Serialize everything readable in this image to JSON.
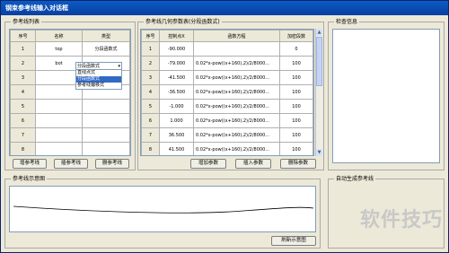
{
  "window": {
    "title": "钢束参考线输入对话框"
  },
  "ref_list": {
    "label": "参考线列表",
    "headers": [
      "序号",
      "名称",
      "类型"
    ],
    "rows": [
      {
        "n": "1",
        "name": "top",
        "type": "分段函数式"
      },
      {
        "n": "2",
        "name": "bot",
        "type": ""
      },
      {
        "n": "3",
        "name": "",
        "type": ""
      },
      {
        "n": "4",
        "name": "",
        "type": ""
      },
      {
        "n": "5",
        "name": "",
        "type": ""
      },
      {
        "n": "6",
        "name": "",
        "type": ""
      },
      {
        "n": "7",
        "name": "",
        "type": ""
      },
      {
        "n": "8",
        "name": "",
        "type": ""
      }
    ],
    "dropdown": {
      "selected": "分段函数式",
      "options": [
        "直线点式",
        "分段函数式",
        "参考线偏移式"
      ],
      "highlighted_index": 1
    },
    "buttons": [
      "增参考线",
      "插参考线",
      "删参考线"
    ]
  },
  "param_table": {
    "label": "参考线几何参数表(分段函数式)",
    "headers": [
      "序号",
      "控制点X",
      "函数方程",
      "加密段数"
    ],
    "rows": [
      {
        "n": "1",
        "x": "-90.000",
        "f": "",
        "seg": "0"
      },
      {
        "n": "2",
        "x": "-79.000",
        "f": "0.02*x-pow((x+160),2)/2/8000...",
        "seg": "100"
      },
      {
        "n": "3",
        "x": "-41.500",
        "f": "0.02*x-pow((x+160),2)/2/8000...",
        "seg": "100"
      },
      {
        "n": "4",
        "x": "-36.500",
        "f": "0.02*x-pow((x+160),2)/2/8000...",
        "seg": "100"
      },
      {
        "n": "5",
        "x": "-1.000",
        "f": "0.02*x-pow((x+160),2)/2/8000...",
        "seg": "100"
      },
      {
        "n": "6",
        "x": "1.000",
        "f": "0.02*x-pow((x+160),2)/2/8000...",
        "seg": "100"
      },
      {
        "n": "7",
        "x": "36.500",
        "f": "0.02*x-pow((x+160),2)/2/8000...",
        "seg": "100"
      },
      {
        "n": "8",
        "x": "41.500",
        "f": "0.02*x-pow((x+160),2)/2/8000...",
        "seg": "100"
      }
    ],
    "buttons": [
      "增加参数",
      "插入参数",
      "删除参数"
    ]
  },
  "check_info": {
    "label": "检查信息"
  },
  "sketch": {
    "label": "参考线示意图",
    "refresh_button": "刷新示意图"
  },
  "auto_gen": {
    "label": "自动生成参考线"
  },
  "watermark": "软件技巧"
}
